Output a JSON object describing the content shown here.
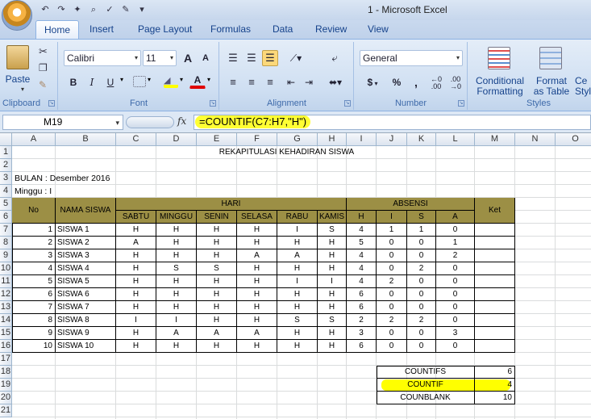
{
  "window": {
    "title": "1 - Microsoft Excel"
  },
  "tabs": [
    {
      "label": "Home"
    },
    {
      "label": "Insert"
    },
    {
      "label": "Page Layout"
    },
    {
      "label": "Formulas"
    },
    {
      "label": "Data"
    },
    {
      "label": "Review"
    },
    {
      "label": "View"
    }
  ],
  "ribbon": {
    "clipboard": {
      "label": "Clipboard",
      "paste": "Paste"
    },
    "font": {
      "label": "Font",
      "name": "Calibri",
      "size": "11",
      "grow": "A",
      "shrink": "A",
      "bold": "B",
      "italic": "I",
      "underline": "U",
      "font_color": "A"
    },
    "alignment": {
      "label": "Alignment"
    },
    "number": {
      "label": "Number",
      "format": "General",
      "currency": "$",
      "percent": "%",
      "comma": ",",
      "inc_decimal": ".00",
      "dec_decimal": ".00"
    },
    "styles": {
      "label": "Styles",
      "conditional": "Conditional",
      "conditional2": "Formatting",
      "format_as": "Format",
      "format_as2": "as Table",
      "cell_styles": "Ce",
      "cell_styles2": "Style"
    }
  },
  "formula_bar": {
    "name_box": "M19",
    "fx": "fx",
    "formula": "=COUNTIF(C7:H7,\"H\")"
  },
  "columns": [
    "A",
    "B",
    "C",
    "D",
    "E",
    "F",
    "G",
    "H",
    "I",
    "J",
    "K",
    "L",
    "M",
    "N",
    "O"
  ],
  "rows": [
    "1",
    "2",
    "3",
    "4",
    "5",
    "6",
    "7",
    "8",
    "9",
    "10",
    "11",
    "12",
    "13",
    "14",
    "15",
    "16",
    "17",
    "18",
    "19",
    "20",
    "21"
  ],
  "sheet": {
    "title": "REKAPITULASI KEHADIRAN SISWA",
    "bulan": "BULAN : Desember 2016",
    "minggu": "Minggu : I",
    "headers": {
      "no": "No",
      "nama": "NAMA SISWA",
      "hari": "HARI",
      "absensi": "ABSENSI",
      "ket": "Ket",
      "days": [
        "SABTU",
        "MINGGU",
        "SENIN",
        "SELASA",
        "RABU",
        "KAMIS"
      ],
      "abs": [
        "H",
        "I",
        "S",
        "A"
      ]
    },
    "records": [
      {
        "no": "1",
        "nama": "SISWA 1",
        "days": [
          "H",
          "H",
          "H",
          "H",
          "I",
          "S"
        ],
        "abs": [
          "4",
          "1",
          "1",
          "0"
        ]
      },
      {
        "no": "2",
        "nama": "SISWA 2",
        "days": [
          "A",
          "H",
          "H",
          "H",
          "H",
          "H"
        ],
        "abs": [
          "5",
          "0",
          "0",
          "1"
        ]
      },
      {
        "no": "3",
        "nama": "SISWA 3",
        "days": [
          "H",
          "H",
          "H",
          "A",
          "A",
          "H"
        ],
        "abs": [
          "4",
          "0",
          "0",
          "2"
        ]
      },
      {
        "no": "4",
        "nama": "SISWA 4",
        "days": [
          "H",
          "S",
          "S",
          "H",
          "H",
          "H"
        ],
        "abs": [
          "4",
          "0",
          "2",
          "0"
        ]
      },
      {
        "no": "5",
        "nama": "SISWA 5",
        "days": [
          "H",
          "H",
          "H",
          "H",
          "I",
          "I"
        ],
        "abs": [
          "4",
          "2",
          "0",
          "0"
        ]
      },
      {
        "no": "6",
        "nama": "SISWA 6",
        "days": [
          "H",
          "H",
          "H",
          "H",
          "H",
          "H"
        ],
        "abs": [
          "6",
          "0",
          "0",
          "0"
        ]
      },
      {
        "no": "7",
        "nama": "SISWA 7",
        "days": [
          "H",
          "H",
          "H",
          "H",
          "H",
          "H"
        ],
        "abs": [
          "6",
          "0",
          "0",
          "0"
        ]
      },
      {
        "no": "8",
        "nama": "SISWA 8",
        "days": [
          "I",
          "I",
          "H",
          "H",
          "S",
          "S"
        ],
        "abs": [
          "2",
          "2",
          "2",
          "0"
        ]
      },
      {
        "no": "9",
        "nama": "SISWA 9",
        "days": [
          "H",
          "A",
          "A",
          "A",
          "H",
          "H"
        ],
        "abs": [
          "3",
          "0",
          "0",
          "3"
        ]
      },
      {
        "no": "10",
        "nama": "SISWA 10",
        "days": [
          "H",
          "H",
          "H",
          "H",
          "H",
          "H"
        ],
        "abs": [
          "6",
          "0",
          "0",
          "0"
        ]
      }
    ],
    "summary": [
      {
        "label": "COUNTIFS",
        "value": "6"
      },
      {
        "label": "COUNTIF",
        "value": "4"
      },
      {
        "label": "COUNBLANK",
        "value": "10"
      }
    ]
  }
}
